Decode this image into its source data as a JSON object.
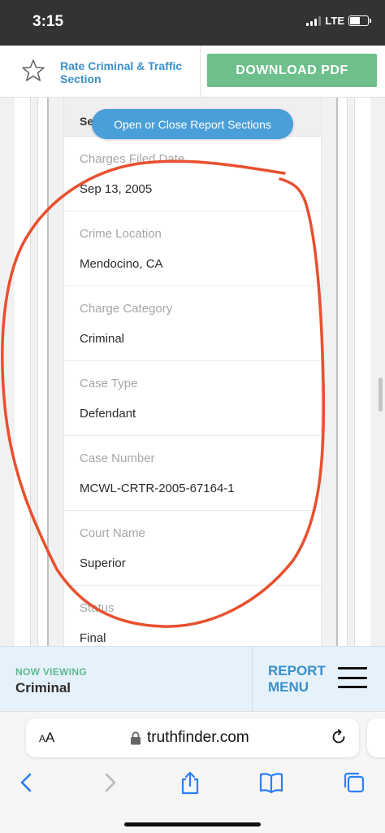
{
  "status_bar": {
    "time": "3:15",
    "network": "LTE",
    "signal_bars_active": 3,
    "signal_bars_total": 4,
    "battery_level": 0.55
  },
  "toolbar": {
    "star_icon": "star-outline-icon",
    "rate_label": "Rate Criminal & Traffic Section",
    "download_label": "DOWNLOAD PDF",
    "download_color": "#6dc08b",
    "link_color": "#3c8fc8"
  },
  "card": {
    "header_partial": "Se",
    "fields": [
      {
        "label": "Charges Filed Date",
        "value": "Sep 13, 2005"
      },
      {
        "label": "Crime Location",
        "value": "Mendocino, CA"
      },
      {
        "label": "Charge Category",
        "value": "Criminal"
      },
      {
        "label": "Case Type",
        "value": "Defendant"
      },
      {
        "label": "Case Number",
        "value": "MCWL-CRTR-2005-67164-1"
      },
      {
        "label": "Court Name",
        "value": "Superior"
      },
      {
        "label": "Status",
        "value": "Final"
      }
    ]
  },
  "sections_button": {
    "label": "Open or Close Report Sections",
    "color": "#4a9fd9"
  },
  "annotation": {
    "shape": "hand-drawn circle",
    "color": "#e8502e"
  },
  "now_viewing": {
    "label": "NOW VIEWING",
    "value": "Criminal",
    "report_menu_label": "REPORT MENU",
    "menu_icon": "hamburger-menu-icon"
  },
  "browser": {
    "text_size_label": "AA",
    "url": "truthfinder.com",
    "lock_icon": "lock-icon",
    "reload_icon": "reload-icon",
    "nav_icons": [
      "back-icon",
      "forward-icon",
      "share-icon",
      "bookmarks-icon",
      "tabs-icon"
    ],
    "accent_color": "#2a7ff6"
  }
}
